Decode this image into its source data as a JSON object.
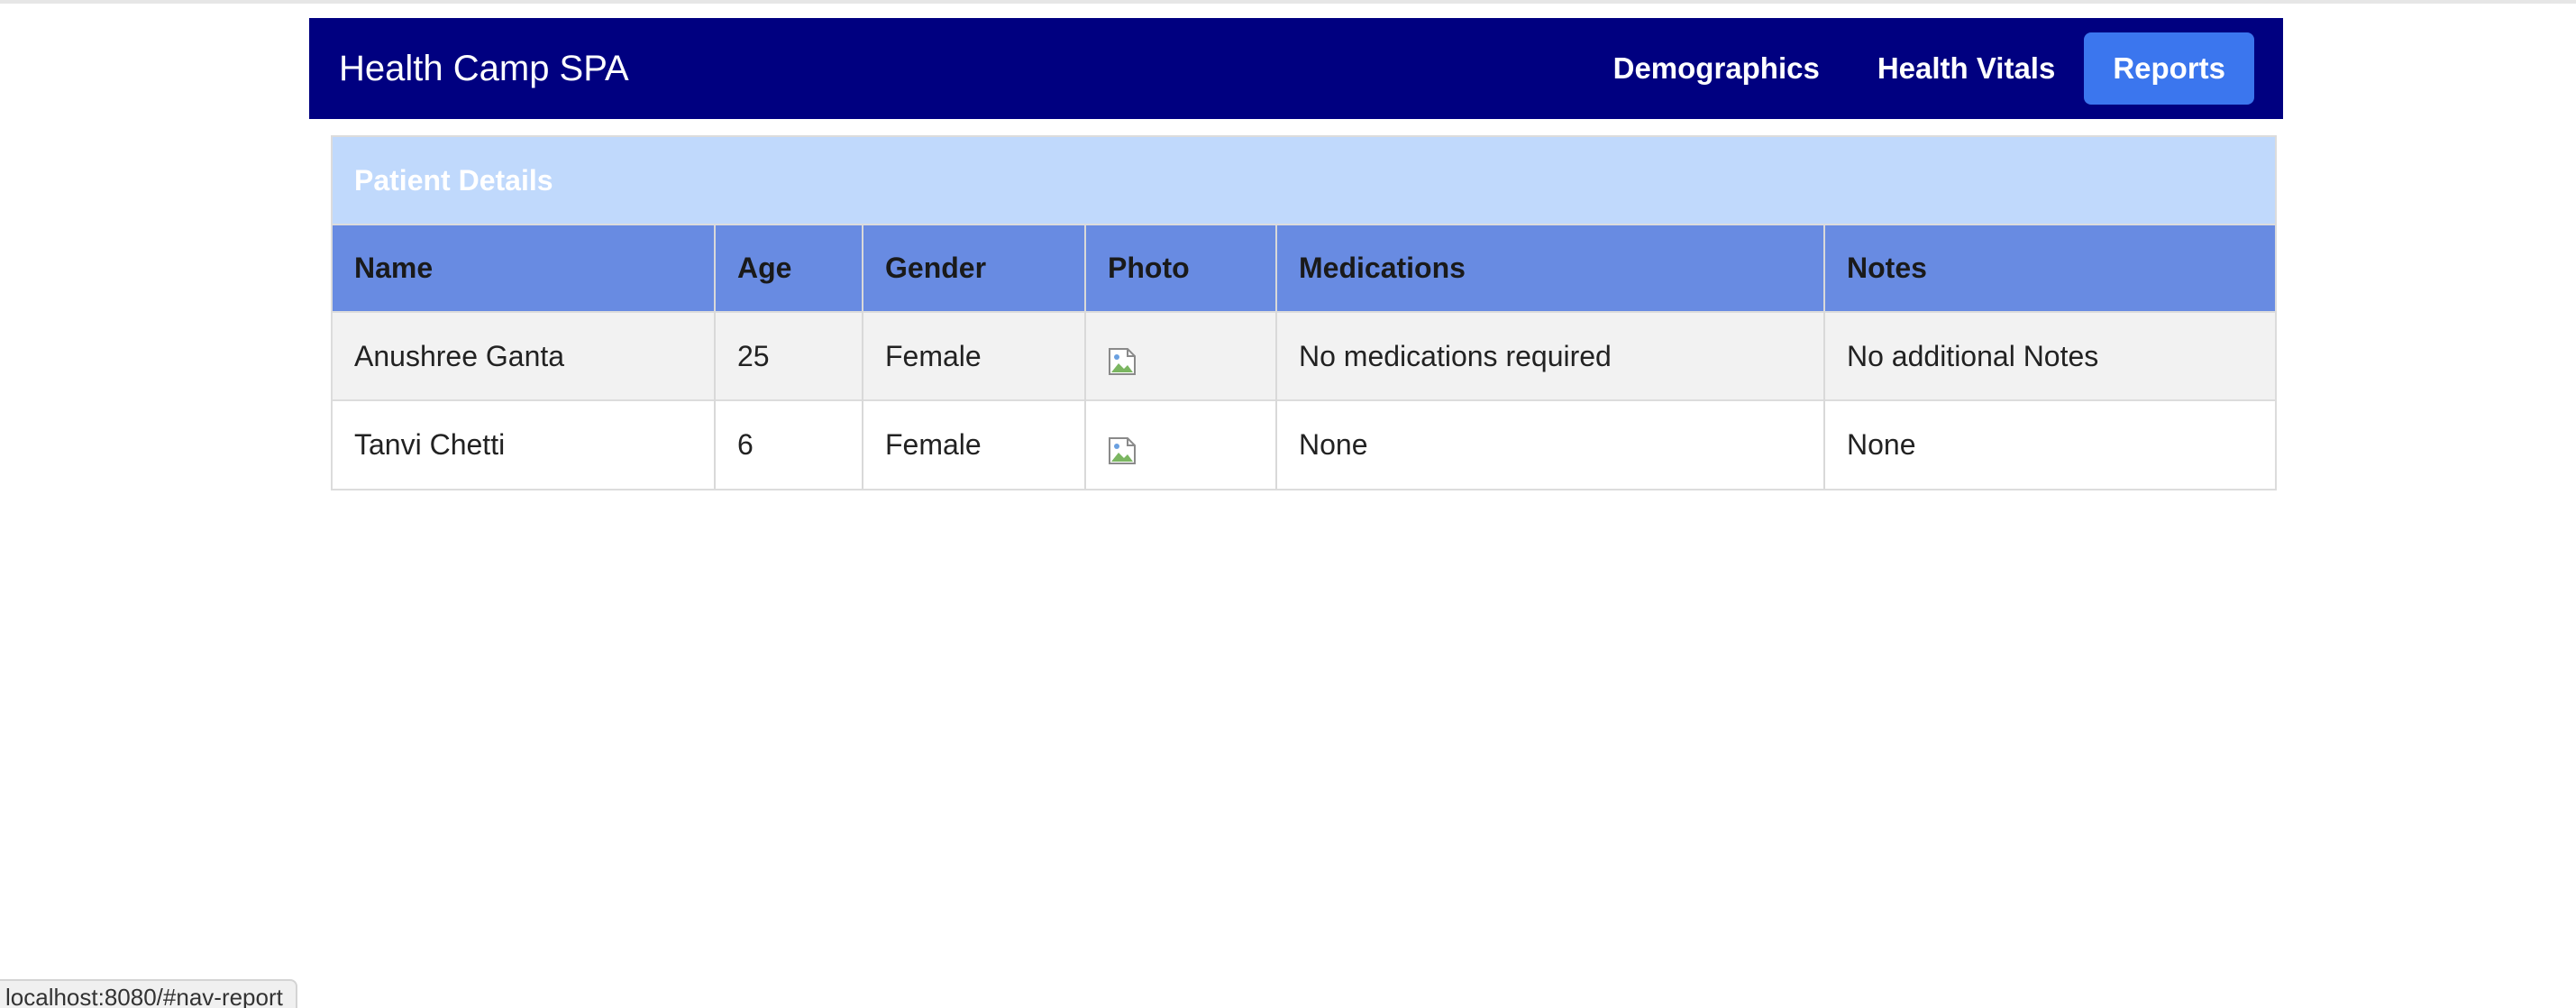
{
  "navbar": {
    "brand": "Health Camp SPA",
    "links": [
      {
        "label": "Demographics",
        "active": false
      },
      {
        "label": "Health Vitals",
        "active": false
      },
      {
        "label": "Reports",
        "active": true
      }
    ]
  },
  "report": {
    "title": "Patient Details",
    "columns": [
      "Name",
      "Age",
      "Gender",
      "Photo",
      "Medications",
      "Notes"
    ],
    "rows": [
      {
        "name": "Anushree Ganta",
        "age": "25",
        "gender": "Female",
        "photo": "broken-image-icon",
        "medications": "No medications required",
        "notes": "No additional Notes"
      },
      {
        "name": "Tanvi Chetti",
        "age": "6",
        "gender": "Female",
        "photo": "broken-image-icon",
        "medications": "None",
        "notes": "None"
      }
    ]
  },
  "status_bar": {
    "url": "localhost:8080/#nav-report"
  },
  "colors": {
    "navbar": "#000080",
    "active_link": "#3b76ee",
    "card_header": "#c0d9fc",
    "table_header": "#688be2",
    "odd_row": "#f2f2f2"
  }
}
